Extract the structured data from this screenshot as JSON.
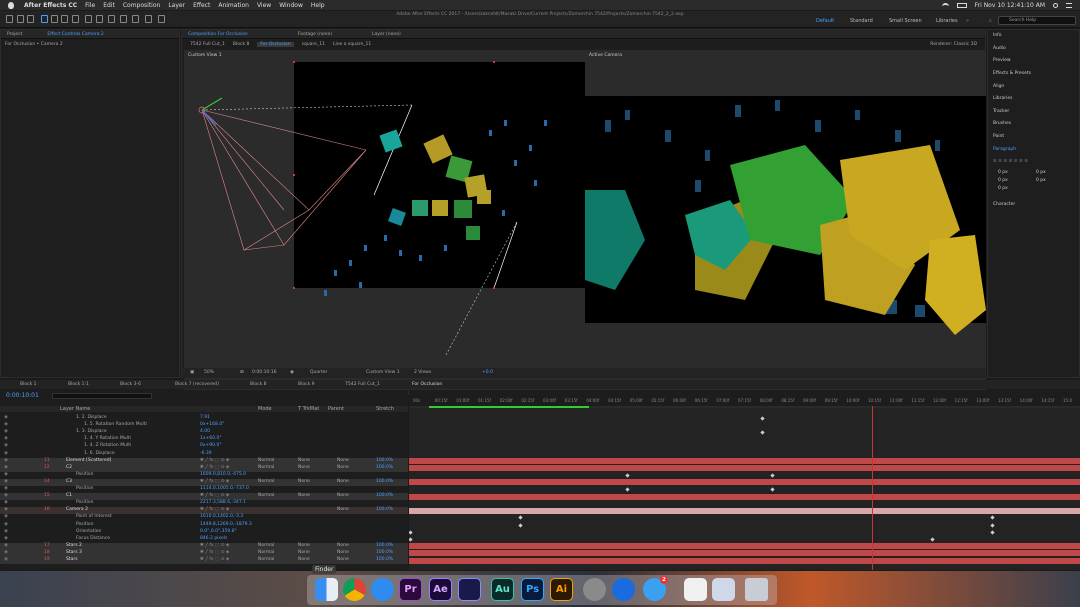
{
  "menubar": {
    "app_name": "After Effects CC",
    "items": [
      "File",
      "Edit",
      "Composition",
      "Layer",
      "Effect",
      "Animation",
      "View",
      "Window",
      "Help"
    ],
    "clock": "Fri Nov 10  12:41:10 AM"
  },
  "window": {
    "title": "Adobe After Effects CC 2017 - /Users/zakcohlt/Masaki Drive/Current Projects/Zomerchin 7542/Projects/Zomerchin 7542_2_2.aep"
  },
  "workspaces": [
    "Default",
    "Standard",
    "Small Screen",
    "Libraries"
  ],
  "search_placeholder": "Search Help",
  "project_panel": {
    "tab_project": "Project",
    "tab_effect_controls": "Effect Controls Camera 2",
    "breadcrumb": "For Occlusion • Camera 2"
  },
  "composition": {
    "tab_label": "Composition For Occlusion",
    "footage_tab": "Footage (none)",
    "layer_tab": "Layer (none)",
    "subtabs": [
      "7542 Full Cut_1",
      "Block 8",
      "For Occlusion",
      "square_11",
      "Line a square_11"
    ],
    "renderer": "Renderer:  Classic 3D",
    "left_view": "Custom View 1",
    "right_view": "Active Camera",
    "footer": {
      "zoom": "50%",
      "timecode": "0:00:10:16",
      "quality": "Quarter",
      "view": "Custom View 1",
      "views": "2 Views",
      "exposure": "+0.0"
    }
  },
  "right_panel": {
    "items": [
      "Info",
      "Audio",
      "Preview",
      "Effects & Presets",
      "Align",
      "Libraries",
      "Tracker",
      "Brushes",
      "Paint",
      "Paragraph",
      "Character"
    ],
    "paragraph_fields": [
      "0 px",
      "0 px",
      "0 px",
      "0 px",
      "0 px"
    ]
  },
  "timeline": {
    "tabs": [
      "Block 1",
      "Block 1:1",
      "Block 3-6",
      "Block 7 (recovered)",
      "Block 8",
      "Block 9",
      "7542 Full Cut_1",
      "For Occlusion"
    ],
    "timecode": "0:00:10:01",
    "columns": [
      "Layer Name",
      "Mode",
      "T TrkMat",
      "Parent",
      "Stretch"
    ],
    "layers": [
      {
        "indent": 2,
        "name": "1.  2. Displace",
        "value": "7.91",
        "type": "prop"
      },
      {
        "indent": 3,
        "name": "1.  5. Rotation Random Multi",
        "value": "0x+168.0°",
        "type": "prop"
      },
      {
        "indent": 2,
        "name": "1.  3. Displace",
        "value": "4.00",
        "type": "prop"
      },
      {
        "indent": 3,
        "name": "1.  4. Y Rotation Multi",
        "value": "1x+60.0°",
        "type": "prop"
      },
      {
        "indent": 3,
        "name": "1.  4. Z Rotation Multi",
        "value": "0x+90.0°",
        "type": "prop"
      },
      {
        "indent": 3,
        "name": "1.  6. Displace",
        "value": "-6.39",
        "type": "prop"
      },
      {
        "num": "11",
        "name": "Element [Scattered]",
        "mode": "Normal",
        "trk": "None",
        "parent": "None",
        "stretch": "100.0%",
        "type": "layer"
      },
      {
        "num": "12",
        "name": "C2",
        "mode": "Normal",
        "trk": "None",
        "parent": "None",
        "stretch": "100.0%",
        "type": "layer"
      },
      {
        "indent": 2,
        "name": "Position",
        "value": "1609.0,810.0,-475.0",
        "type": "prop"
      },
      {
        "num": "14",
        "name": "C3",
        "mode": "Normal",
        "trk": "None",
        "parent": "None",
        "stretch": "100.0%",
        "type": "layer"
      },
      {
        "indent": 2,
        "name": "Position",
        "value": "1114.0,1005.0,-737.0",
        "type": "prop"
      },
      {
        "num": "15",
        "name": "C1",
        "mode": "Normal",
        "trk": "None",
        "parent": "None",
        "stretch": "100.0%",
        "type": "layer"
      },
      {
        "indent": 2,
        "name": "Position",
        "value": "2217.3,588.6,-347.1",
        "type": "prop"
      },
      {
        "num": "16",
        "name": "Camera 2",
        "mode": "",
        "trk": "",
        "parent": "None",
        "stretch": "100.0%",
        "type": "camera"
      },
      {
        "indent": 2,
        "name": "Point of Interest",
        "value": "1610.0,1402.0,-3.3",
        "type": "prop"
      },
      {
        "indent": 2,
        "name": "Position",
        "value": "1449.8,1269.0,-1879.3",
        "type": "prop"
      },
      {
        "indent": 2,
        "name": "Orientation",
        "value": "0.0°,0.0°,359.8°",
        "type": "prop"
      },
      {
        "indent": 2,
        "name": "Focus Distance",
        "value": "846.2 pixels",
        "type": "prop"
      },
      {
        "num": "17",
        "name": "Stars 2",
        "mode": "Normal",
        "trk": "None",
        "parent": "None",
        "stretch": "100.0%",
        "type": "layer"
      },
      {
        "num": "18",
        "name": "Stars 3",
        "mode": "Normal",
        "trk": "None",
        "parent": "None",
        "stretch": "100.0%",
        "type": "layer"
      },
      {
        "num": "19",
        "name": "Stars",
        "mode": "Normal",
        "trk": "None",
        "parent": "None",
        "stretch": "100.0%",
        "type": "layer"
      }
    ],
    "ruler": [
      "00s",
      "00:15f",
      "01:00f",
      "01:15f",
      "02:00f",
      "02:15f",
      "03:00f",
      "03:15f",
      "04:00f",
      "04:15f",
      "05:00f",
      "05:15f",
      "06:00f",
      "06:15f",
      "07:00f",
      "07:15f",
      "08:00f",
      "08:15f",
      "09:00f",
      "09:15f",
      "10:00f",
      "10:15f",
      "11:00f",
      "11:15f",
      "12:00f",
      "12:15f",
      "13:00f",
      "13:15f",
      "14:00f",
      "14:15f",
      "15:0"
    ]
  },
  "dock": {
    "tooltip": "Finder",
    "apps": [
      {
        "name": "Finder",
        "label": ""
      },
      {
        "name": "Chrome",
        "label": ""
      },
      {
        "name": "Safari",
        "label": ""
      },
      {
        "name": "Premiere",
        "label": "Pr"
      },
      {
        "name": "After Effects",
        "label": "Ae"
      },
      {
        "name": "Media Encoder",
        "label": ""
      },
      {
        "name": "Audition",
        "label": "Au"
      },
      {
        "name": "Photoshop",
        "label": "Ps"
      },
      {
        "name": "Illustrator",
        "label": "Ai"
      },
      {
        "name": "System Preferences",
        "label": ""
      },
      {
        "name": "TeamViewer",
        "label": ""
      },
      {
        "name": "Messages",
        "label": "",
        "badge": "2"
      },
      {
        "name": "Document",
        "label": ""
      },
      {
        "name": "Preview",
        "label": ""
      },
      {
        "name": "Trash",
        "label": ""
      }
    ]
  },
  "colors": {
    "accent": "#4aa0ff",
    "layer_bar": "#c04848",
    "camera_bar": "#d8a8a8"
  }
}
